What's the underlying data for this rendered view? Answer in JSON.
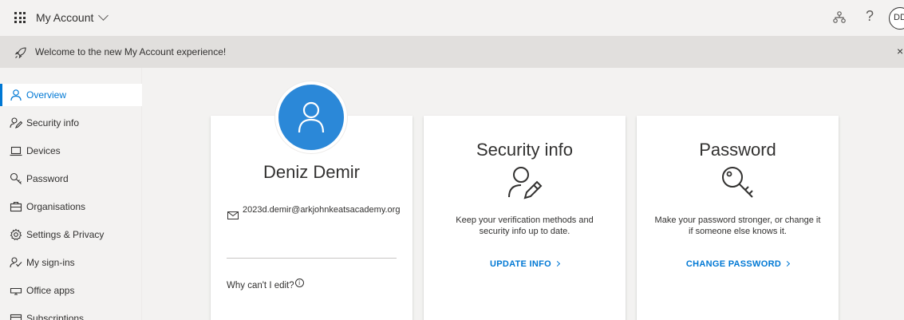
{
  "header": {
    "app_title": "My Account",
    "avatar_initials": "DD",
    "help_glyph": "?"
  },
  "banner": {
    "text": "Welcome to the new My Account experience!",
    "close_glyph": "×"
  },
  "sidebar": {
    "items": [
      {
        "label": "Overview",
        "icon": "person-icon",
        "active": true
      },
      {
        "label": "Security info",
        "icon": "security-info-icon"
      },
      {
        "label": "Devices",
        "icon": "laptop-icon"
      },
      {
        "label": "Password",
        "icon": "key-icon"
      },
      {
        "label": "Organisations",
        "icon": "briefcase-icon"
      },
      {
        "label": "Settings & Privacy",
        "icon": "gear-icon"
      },
      {
        "label": "My sign-ins",
        "icon": "sign-ins-icon"
      },
      {
        "label": "Office apps",
        "icon": "office-apps-icon"
      },
      {
        "label": "Subscriptions",
        "icon": "subscriptions-icon"
      }
    ]
  },
  "profile": {
    "name": "Deniz Demir",
    "email": "2023d.demir@arkjohnkeatsacademy.org",
    "why_edit": "Why can't I edit?",
    "info_glyph": "i"
  },
  "security_card": {
    "title": "Security info",
    "description": "Keep your verification methods and security info up to date.",
    "link": "UPDATE INFO"
  },
  "password_card": {
    "title": "Password",
    "description": "Make your password stronger, or change it if someone else knows it.",
    "link": "CHANGE PASSWORD"
  },
  "colors": {
    "accent": "#0078d4",
    "avatar_bg": "#2b88d8"
  }
}
